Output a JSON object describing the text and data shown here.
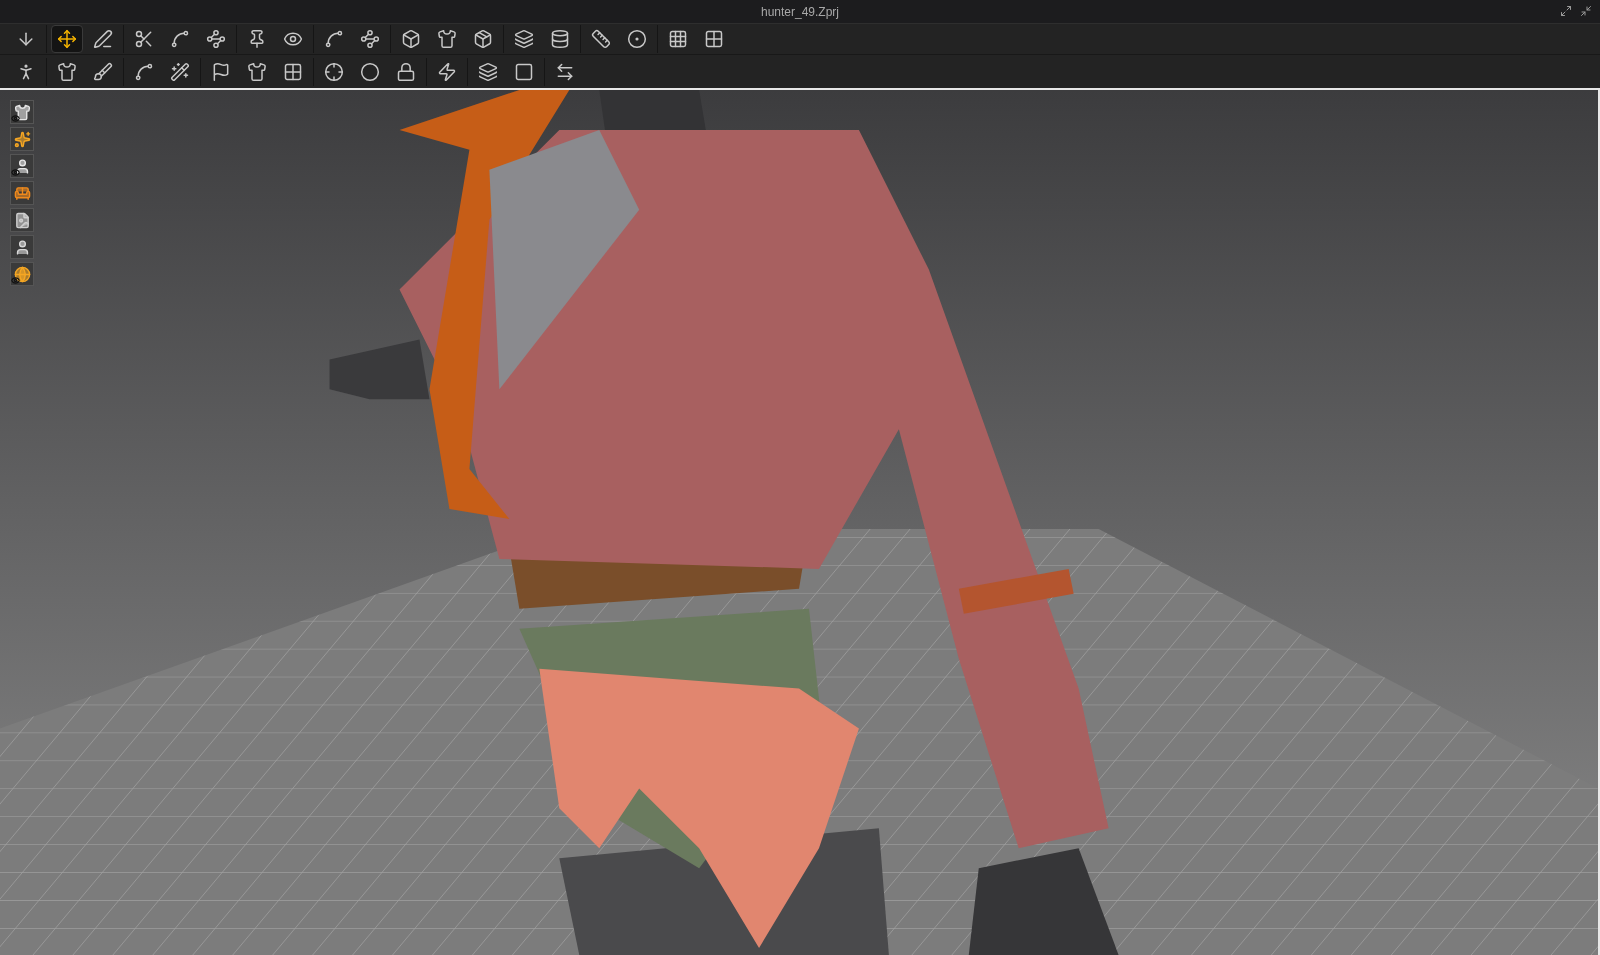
{
  "window": {
    "title": "hunter_49.Zprj"
  },
  "toolbars": [
    [
      [
        {
          "selected": false
        }
      ],
      [
        {
          "selected": true
        },
        {
          "selected": false
        }
      ],
      [
        {
          "selected": false
        },
        {
          "selected": false
        },
        {
          "selected": false
        }
      ],
      [
        {
          "selected": false
        },
        {
          "selected": false
        }
      ],
      [
        {
          "selected": false
        },
        {
          "selected": false
        }
      ],
      [
        {
          "selected": false
        },
        {
          "selected": false
        },
        {
          "selected": false
        }
      ],
      [
        {
          "selected": false
        },
        {
          "selected": false
        }
      ],
      [
        {
          "selected": false
        },
        {
          "selected": false
        }
      ],
      [
        {
          "selected": false
        },
        {
          "selected": false
        }
      ]
    ],
    [
      [
        {
          "selected": false
        }
      ],
      [
        {
          "selected": false
        },
        {
          "selected": false
        }
      ],
      [
        {
          "selected": false
        },
        {
          "selected": false
        }
      ],
      [
        {
          "selected": false
        },
        {
          "selected": false
        },
        {
          "selected": false
        }
      ],
      [
        {
          "selected": false
        },
        {
          "selected": false
        },
        {
          "selected": false
        }
      ],
      [
        {
          "selected": false
        }
      ],
      [
        {
          "selected": false
        },
        {
          "selected": false
        }
      ],
      [
        {
          "selected": false
        }
      ]
    ]
  ],
  "display_toggles": [
    {
      "shown": true
    },
    {
      "shown": false
    },
    {
      "shown": true
    },
    {
      "shown": false
    },
    {
      "shown": false
    },
    {
      "shown": false
    },
    {
      "shown": true
    }
  ],
  "viewport": {
    "kind": "picture"
  }
}
